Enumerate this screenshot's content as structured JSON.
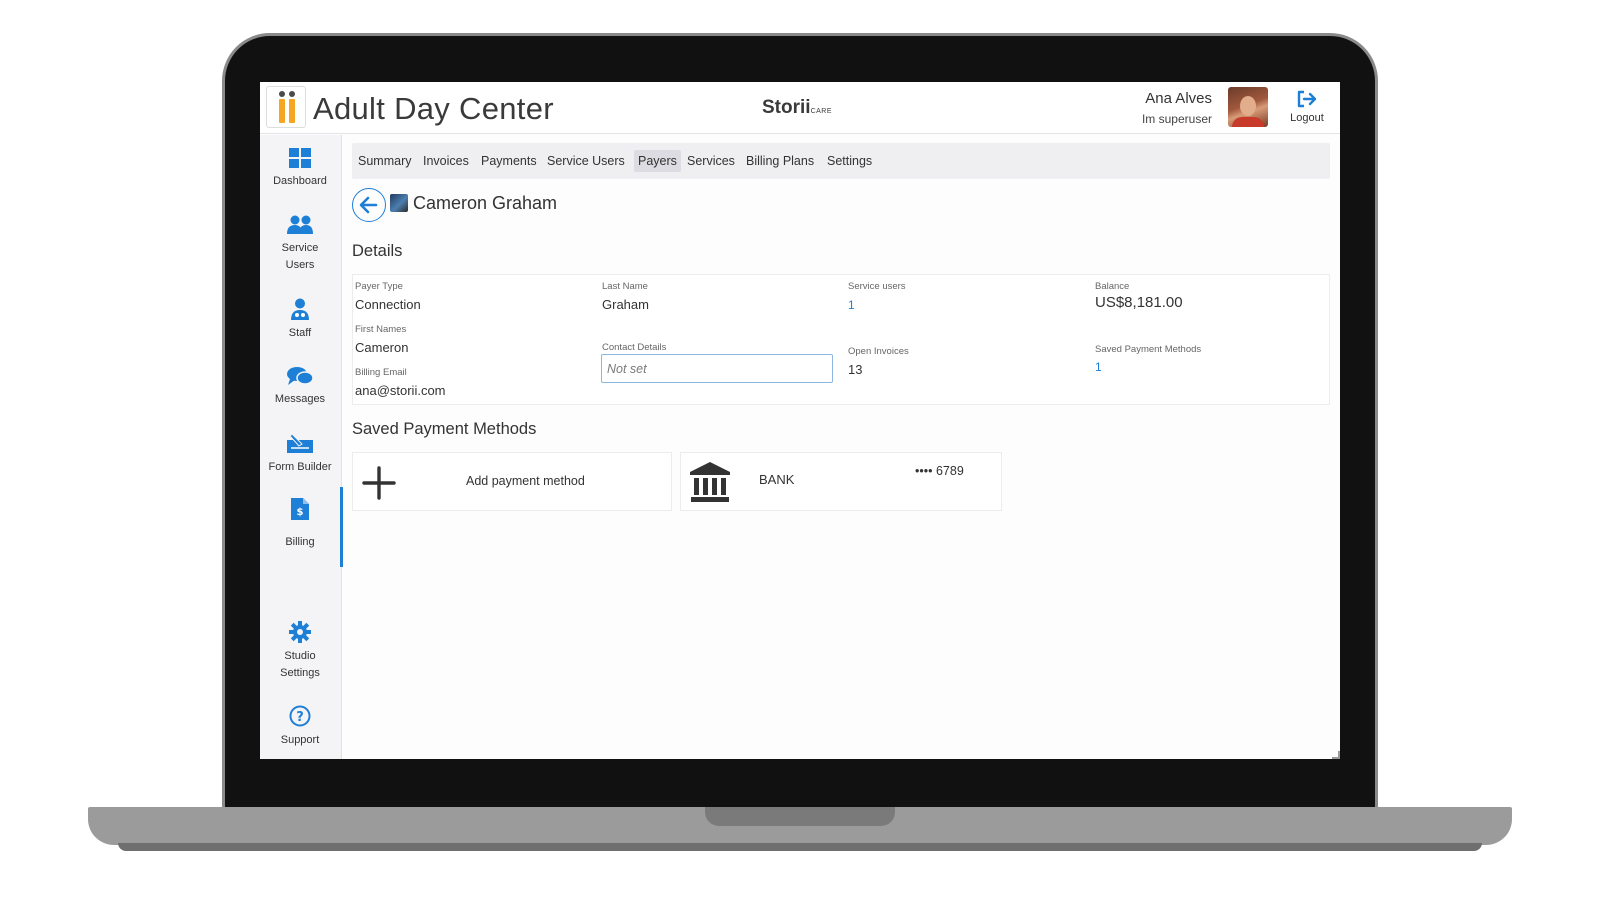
{
  "header": {
    "app_title": "Adult Day Center",
    "brand_main": "Storii",
    "brand_sub": "CARE",
    "user_name": "Ana Alves",
    "user_role": "Im superuser",
    "logout_label": "Logout"
  },
  "sidebar": {
    "items": [
      {
        "label": "Dashboard",
        "icon": "grid-icon"
      },
      {
        "label": "Service Users",
        "icon": "users-icon"
      },
      {
        "label": "Staff",
        "icon": "staff-icon"
      },
      {
        "label": "Messages",
        "icon": "chat-icon"
      },
      {
        "label": "Form Builder",
        "icon": "form-builder-icon"
      },
      {
        "label": "Billing",
        "icon": "billing-icon"
      },
      {
        "label": "Studio Settings",
        "icon": "gear-icon"
      },
      {
        "label": "Support",
        "icon": "question-icon"
      }
    ],
    "active": "Billing",
    "accent_color": "#1e7fd6"
  },
  "tabs": {
    "items": [
      "Summary",
      "Invoices",
      "Payments",
      "Service Users",
      "Payers",
      "Services",
      "Billing Plans",
      "Settings"
    ],
    "active": "Payers"
  },
  "payer": {
    "name": "Cameron Graham"
  },
  "details": {
    "title": "Details",
    "payer_type_label": "Payer Type",
    "payer_type": "Connection",
    "first_names_label": "First Names",
    "first_names": "Cameron",
    "billing_email_label": "Billing Email",
    "billing_email": "ana@storii.com",
    "last_name_label": "Last Name",
    "last_name": "Graham",
    "contact_details_label": "Contact Details",
    "contact_details_placeholder": "Not set",
    "service_users_label": "Service users",
    "service_users": "1",
    "open_invoices_label": "Open Invoices",
    "open_invoices": "13",
    "balance_label": "Balance",
    "balance": "US$8,181.00",
    "saved_methods_label": "Saved Payment Methods",
    "saved_methods": "1"
  },
  "payment_methods": {
    "title": "Saved Payment Methods",
    "add_label": "Add payment method",
    "bank_label": "BANK",
    "bank_number": "•••• 6789"
  }
}
